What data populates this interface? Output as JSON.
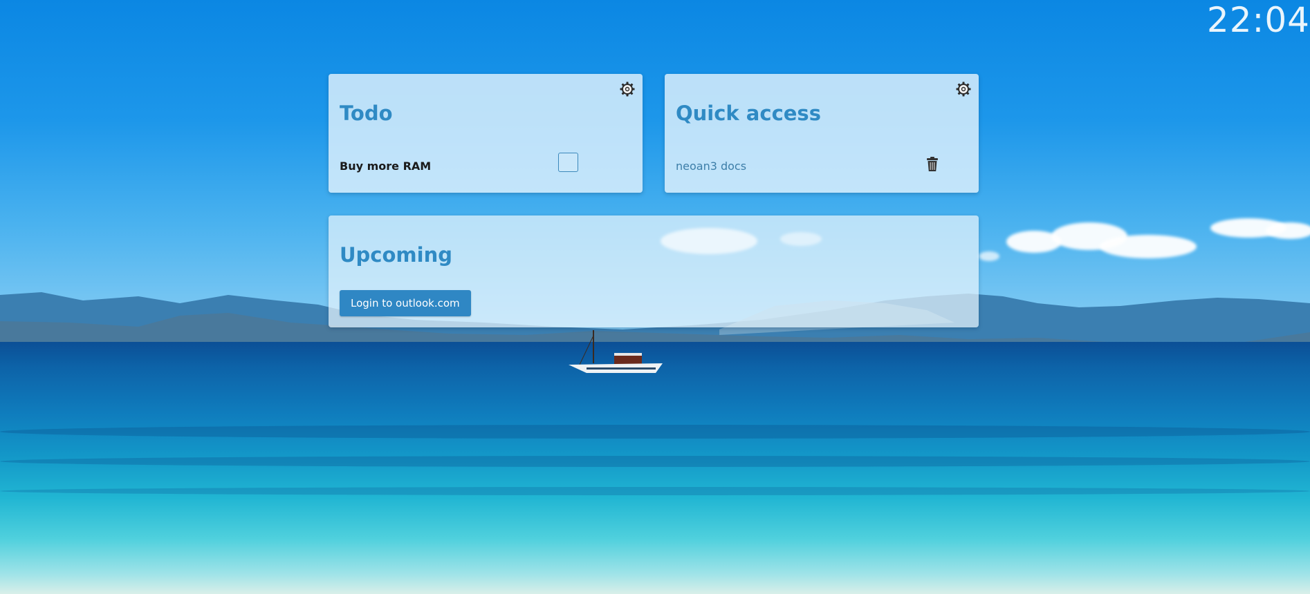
{
  "clock": {
    "time": "22:04"
  },
  "todo": {
    "title": "Todo",
    "settings_icon": "gear-icon",
    "items": [
      {
        "label": "Buy more RAM",
        "checked": false
      }
    ]
  },
  "quick_access": {
    "title": "Quick access",
    "settings_icon": "gear-icon",
    "links": [
      {
        "label": "neoan3 docs",
        "delete_icon": "trash-icon"
      }
    ]
  },
  "upcoming": {
    "title": "Upcoming",
    "login_button": "Login to outlook.com"
  },
  "colors": {
    "accent": "#2f87c4",
    "title": "#2f8ac4",
    "link": "#3d7ea8",
    "card_bg": "#e0f2fc"
  }
}
